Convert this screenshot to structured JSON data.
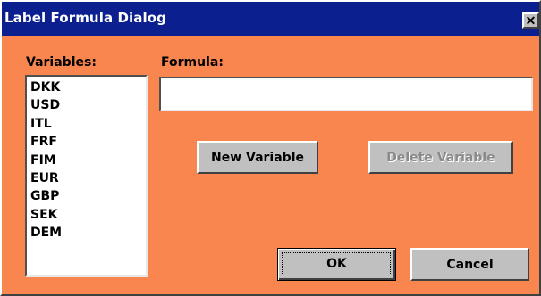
{
  "window": {
    "title": "Label Formula Dialog",
    "close_glyph": "✕",
    "background_color": "#f9854f",
    "titlebar_color": "#0b1f8f"
  },
  "variables": {
    "label": "Variables:",
    "items": [
      "DKK",
      "USD",
      "ITL",
      "FRF",
      "FIM",
      "EUR",
      "GBP",
      "SEK",
      "DEM"
    ]
  },
  "formula": {
    "label": "Formula:",
    "value": ""
  },
  "buttons": {
    "new_variable": "New Variable",
    "delete_variable": "Delete Variable",
    "ok": "OK",
    "cancel": "Cancel"
  }
}
